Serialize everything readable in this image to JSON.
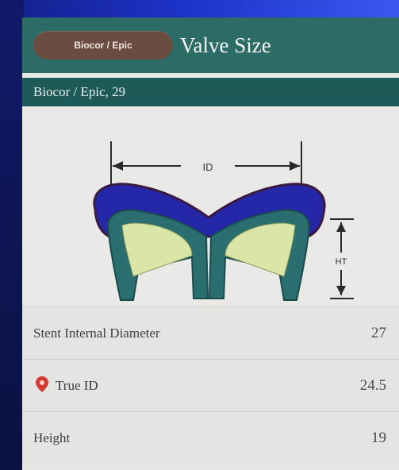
{
  "header": {
    "back_label": "Biocor / Epic",
    "title": "Valve Size"
  },
  "subheader": "Biocor / Epic, 29",
  "diagram": {
    "id_label": "ID",
    "ht_label": "HT"
  },
  "rows": [
    {
      "label": "Stent Internal Diameter",
      "value": "27"
    },
    {
      "label": "True ID",
      "value": "24.5",
      "icon": "red-location-pin-icon"
    },
    {
      "label": "Height",
      "value": "19"
    }
  ],
  "colors": {
    "header_teal": "#2c6b66",
    "back_button": "#6a4c41",
    "diagram_blue": "#2327a8",
    "diagram_teal": "#2a6e70",
    "leaflet_green": "#d9e6a8",
    "pin_red": "#d33a32"
  }
}
